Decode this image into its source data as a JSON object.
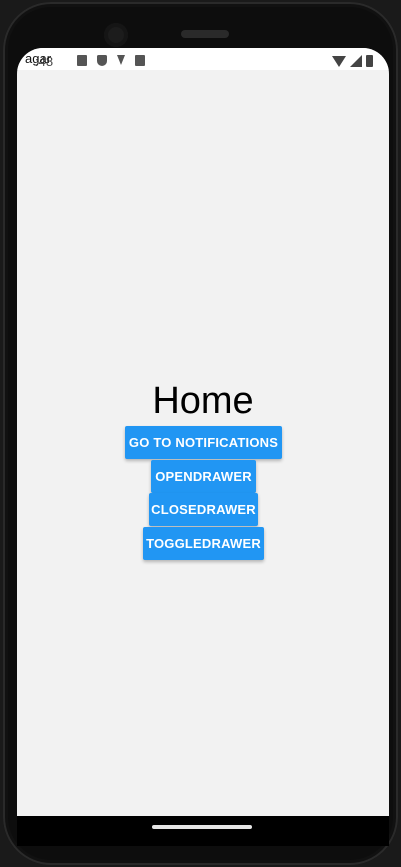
{
  "status_bar": {
    "time": ":48",
    "overlay_text": "agar"
  },
  "home": {
    "title": "Home",
    "buttons": [
      "GO TO NOTIFICATIONS",
      "OPENDRAWER",
      "CLOSEDRAWER",
      "TOGGLEDRAWER"
    ]
  },
  "colors": {
    "button": "#2196f3",
    "background": "#f2f2f2"
  }
}
